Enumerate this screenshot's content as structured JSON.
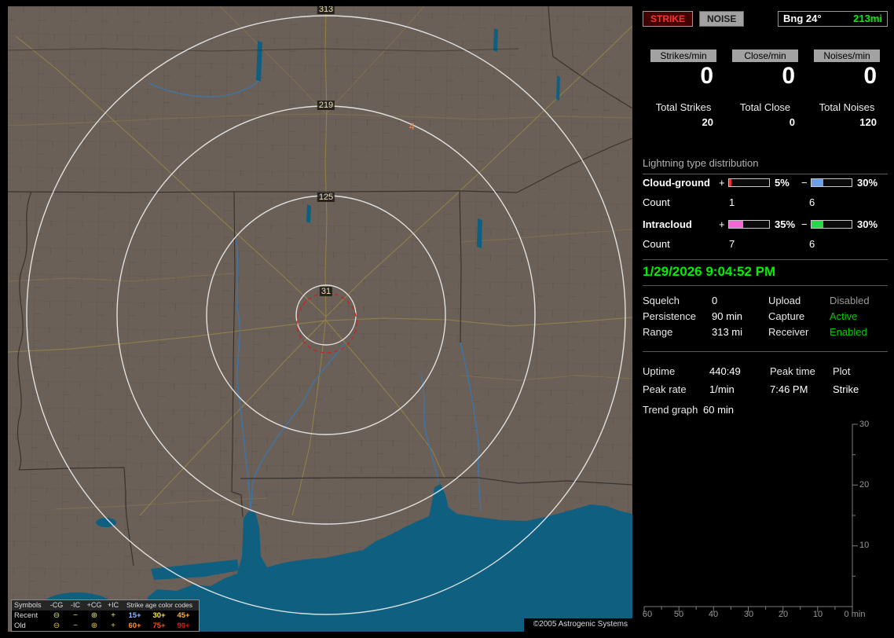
{
  "colors": {
    "accent_green": "#00ee00",
    "strike_red": "#ff3030"
  },
  "map": {
    "ring_labels": [
      "313",
      "219",
      "125",
      "31"
    ],
    "strike_marker": "4",
    "copyright": "©2005 Astrogenic Systems",
    "legend": {
      "title_symbols": "Symbols",
      "symbol_headers": [
        "-CG",
        "-IC",
        "+CG",
        "+IC"
      ],
      "age_header": "Strike age color codes",
      "symbols": [
        "⊖",
        "−",
        "⊕",
        "+"
      ],
      "rows": [
        {
          "label": "Recent",
          "symbol_color": "#dce27e",
          "ages": [
            {
              "text": "15+",
              "color": "#8fbcff"
            },
            {
              "text": "30+",
              "color": "#ffe94a"
            },
            {
              "text": "45+",
              "color": "#ffb23a"
            }
          ]
        },
        {
          "label": "Old",
          "symbol_color": "#e6c23a",
          "ages": [
            {
              "text": "60+",
              "color": "#ff8f2a"
            },
            {
              "text": "75+",
              "color": "#ff4d1a"
            },
            {
              "text": "90+",
              "color": "#ee1414"
            }
          ]
        }
      ]
    }
  },
  "panel": {
    "strike_button": "STRIKE",
    "noise_button": "NOISE",
    "bearing": {
      "label": "Bng 24°",
      "value": "213mi"
    },
    "counters": [
      {
        "label": "Strikes/min",
        "rate": "0",
        "total_label": "Total Strikes",
        "total": "20"
      },
      {
        "label": "Close/min",
        "rate": "0",
        "total_label": "Total Close",
        "total": "0"
      },
      {
        "label": "Noises/min",
        "rate": "0",
        "total_label": "Total Noises",
        "total": "120"
      }
    ],
    "distribution": {
      "title": "Lightning type distribution",
      "count_label": "Count",
      "rows": [
        {
          "label": "Cloud-ground",
          "plus_sign": "+",
          "minus_sign": "−",
          "plus_pct": "5%",
          "plus_width": 5,
          "plus_color": "#e23030",
          "minus_pct": "30%",
          "minus_width": 30,
          "minus_color": "#6ba0e8",
          "plus_count": "1",
          "minus_count": "6"
        },
        {
          "label": "Intracloud",
          "plus_sign": "+",
          "minus_sign": "−",
          "plus_pct": "35%",
          "plus_width": 35,
          "plus_color": "#f06ad2",
          "minus_pct": "30%",
          "minus_width": 30,
          "minus_color": "#28d84a",
          "plus_count": "7",
          "minus_count": "6"
        }
      ]
    },
    "datetime": "1/29/2026 9:04:52 PM",
    "status": {
      "rows": [
        {
          "label": "Squelch",
          "value": "0",
          "label2": "Upload",
          "value2": "Disabled",
          "value2_color": "#9a9a9a"
        },
        {
          "label": "Persistence",
          "value": "90 min",
          "label2": "Capture",
          "value2": "Active",
          "value2_color": "#00cc00"
        },
        {
          "label": "Range",
          "value": "313 mi",
          "label2": "Receiver",
          "value2": "Enabled",
          "value2_color": "#00cc00"
        }
      ]
    },
    "stats": {
      "uptime_label": "Uptime",
      "uptime_value": "440:49",
      "peak_time_label": "Peak time",
      "peak_time_value": "7:46 PM",
      "plot_label": "Plot",
      "plot_value": "Strike",
      "peak_rate_label": "Peak rate",
      "peak_rate_value": "1/min",
      "trend_label": "Trend graph",
      "trend_window": "60 min"
    },
    "trend": {
      "y_ticks": [
        "30",
        "20",
        "10"
      ],
      "x_ticks": [
        "60",
        "50",
        "40",
        "30",
        "20",
        "10",
        "0 min"
      ]
    }
  }
}
